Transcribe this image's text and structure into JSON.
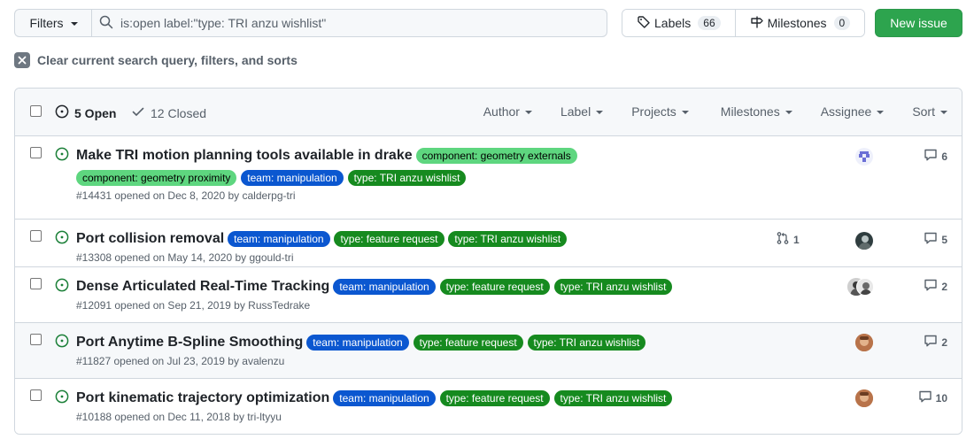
{
  "filters": {
    "label": "Filters"
  },
  "search": {
    "value": "is:open label:\"type: TRI anzu wishlist\""
  },
  "labels_btn": {
    "label": "Labels",
    "count": "66"
  },
  "milestones_btn": {
    "label": "Milestones",
    "count": "0"
  },
  "new_issue": {
    "label": "New issue"
  },
  "clear_query": {
    "label": "Clear current search query, filters, and sorts"
  },
  "header": {
    "open": "5 Open",
    "closed": "12 Closed",
    "filters": [
      "Author",
      "Label",
      "Projects",
      "Milestones",
      "Assignee",
      "Sort"
    ]
  },
  "label_colors": {
    "component: geometry externals": {
      "bg": "#5ed67f",
      "fg": "#000000"
    },
    "component: geometry proximity": {
      "bg": "#5ed67f",
      "fg": "#000000"
    },
    "team: manipulation": {
      "bg": "#0b57d0",
      "fg": "#ffffff"
    },
    "type: feature request": {
      "bg": "#168a1f",
      "fg": "#ffffff"
    },
    "type: TRI anzu wishlist": {
      "bg": "#168a1f",
      "fg": "#ffffff"
    }
  },
  "issues": [
    {
      "title": "Make TRI motion planning tools available in drake",
      "labels": [
        "component: geometry externals",
        "component: geometry proximity",
        "team: manipulation",
        "type: TRI anzu wishlist"
      ],
      "meta": "#14431 opened on Dec 8, 2020 by calderpg-tri",
      "comments": "6",
      "linked_prs": "",
      "avatar": "identicon"
    },
    {
      "title": "Port collision removal",
      "labels": [
        "team: manipulation",
        "type: feature request",
        "type: TRI anzu wishlist"
      ],
      "meta": "#13308 opened on May 14, 2020 by ggould-tri",
      "comments": "5",
      "linked_prs": "1",
      "avatar": "photo-dark"
    },
    {
      "title": "Dense Articulated Real-Time Tracking",
      "labels": [
        "team: manipulation",
        "type: feature request",
        "type: TRI anzu wishlist"
      ],
      "meta": "#12091 opened on Sep 21, 2019 by RussTedrake",
      "comments": "2",
      "linked_prs": "",
      "avatar": "photo-pair"
    },
    {
      "title": "Port Anytime B-Spline Smoothing",
      "labels": [
        "team: manipulation",
        "type: feature request",
        "type: TRI anzu wishlist"
      ],
      "meta": "#11827 opened on Jul 23, 2019 by avalenzu",
      "comments": "2",
      "linked_prs": "",
      "avatar": "photo-warm"
    },
    {
      "title": "Port kinematic trajectory optimization",
      "labels": [
        "team: manipulation",
        "type: feature request",
        "type: TRI anzu wishlist"
      ],
      "meta": "#10188 opened on Dec 11, 2018 by tri-ltyyu",
      "comments": "10",
      "linked_prs": "",
      "avatar": "photo-warm"
    }
  ]
}
